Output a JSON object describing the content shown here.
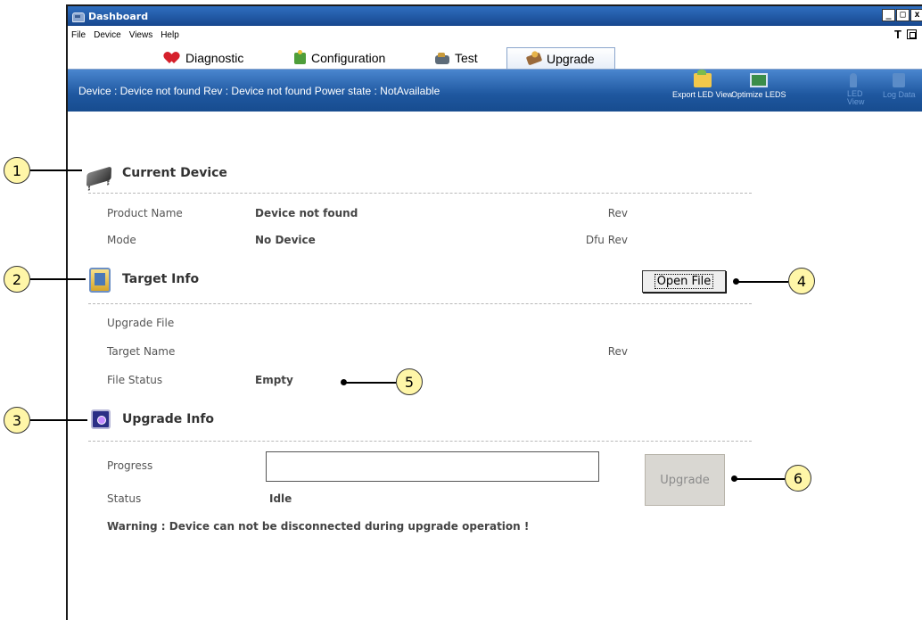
{
  "window": {
    "title": "Dashboard",
    "controls": [
      "_",
      "□",
      "x"
    ]
  },
  "menu": {
    "items": [
      "File",
      "Device",
      "Views",
      "Help"
    ],
    "right_text": "T"
  },
  "tabs": [
    {
      "label": "Diagnostic",
      "icon": "heart-icon"
    },
    {
      "label": "Configuration",
      "icon": "puzzle-icon"
    },
    {
      "label": "Test",
      "icon": "test-icon"
    },
    {
      "label": "Upgrade",
      "icon": "upgrade-tab-icon",
      "active": true
    }
  ],
  "device_bar": {
    "status": "Device :  Device not found Rev :  Device not found Power state :  NotAvailable",
    "tools": [
      {
        "label": "Export LED View",
        "icon": "export-led-view-icon",
        "enabled": true
      },
      {
        "label": "Optimize LEDS",
        "icon": "optimize-leds-icon",
        "enabled": true
      },
      {
        "label": "LED View",
        "icon": "led-view-icon",
        "enabled": false
      },
      {
        "label": "Log Data",
        "icon": "log-data-icon",
        "enabled": false
      }
    ]
  },
  "current_device": {
    "title": "Current Device",
    "product_name_label": "Product Name",
    "product_name_value": "Device not found",
    "rev_label": "Rev",
    "mode_label": "Mode",
    "mode_value": "No Device",
    "dfu_rev_label": "Dfu Rev"
  },
  "target_info": {
    "title": "Target Info",
    "open_file_label": "Open File",
    "upgrade_file_label": "Upgrade File",
    "target_name_label": "Target Name",
    "rev_label": "Rev",
    "file_status_label": "File Status",
    "file_status_value": "Empty"
  },
  "upgrade_info": {
    "title": "Upgrade Info",
    "progress_label": "Progress",
    "progress_value": 0,
    "status_label": "Status",
    "status_value": "Idle",
    "upgrade_button_label": "Upgrade",
    "warning": "Warning : Device can not be disconnected during upgrade operation !"
  },
  "callouts": [
    "1",
    "2",
    "3",
    "4",
    "5",
    "6"
  ],
  "colors": {
    "title_bar": "#17478e",
    "device_bar": "#1e579f",
    "callout_fill": "#fff6a8"
  }
}
